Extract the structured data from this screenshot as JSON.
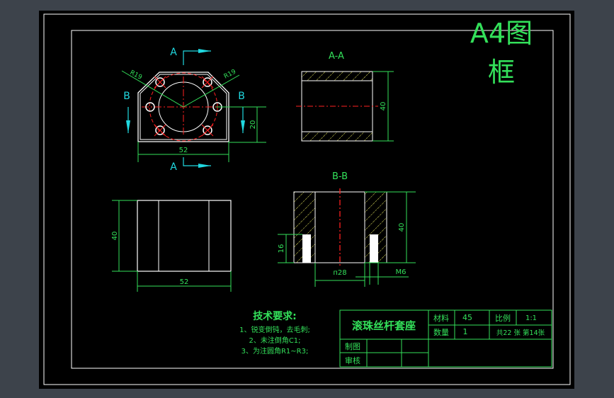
{
  "frame_title": {
    "line1": "A4图",
    "line2": "框"
  },
  "views": {
    "top": {
      "section_a": "A",
      "section_b": "B",
      "r_left": "R19",
      "r_right": "R19",
      "dim_width": "52",
      "dim_height": "20"
    },
    "aa": {
      "title": "A-A",
      "dim_height": "40"
    },
    "front": {
      "dim_height": "40",
      "dim_width": "52"
    },
    "bb": {
      "title": "B-B",
      "dim_height": "40",
      "dim_thread_depth": "16",
      "dim_bore": "п28",
      "dim_thread": "M6"
    }
  },
  "notes": {
    "title": "技术要求:",
    "items": [
      "1、锐变倒钝，去毛刺;",
      "2、未注倒角C1;",
      "3、为注圆角R1~R3;"
    ]
  },
  "title_block": {
    "part_name": "滚珠丝杆套座",
    "material_label": "材料",
    "material_value": "45",
    "scale_label": "比例",
    "scale_value": "1:1",
    "quantity_label": "数量",
    "quantity_value": "1",
    "sheets": "共22 张  第14张",
    "drawn_label": "制图",
    "checked_label": "审核"
  },
  "colors": {
    "line": "#ffffff",
    "dim": "#33e05a",
    "center": "#ff2020",
    "section": "#20d8e0",
    "hatch": "#e8e860"
  }
}
